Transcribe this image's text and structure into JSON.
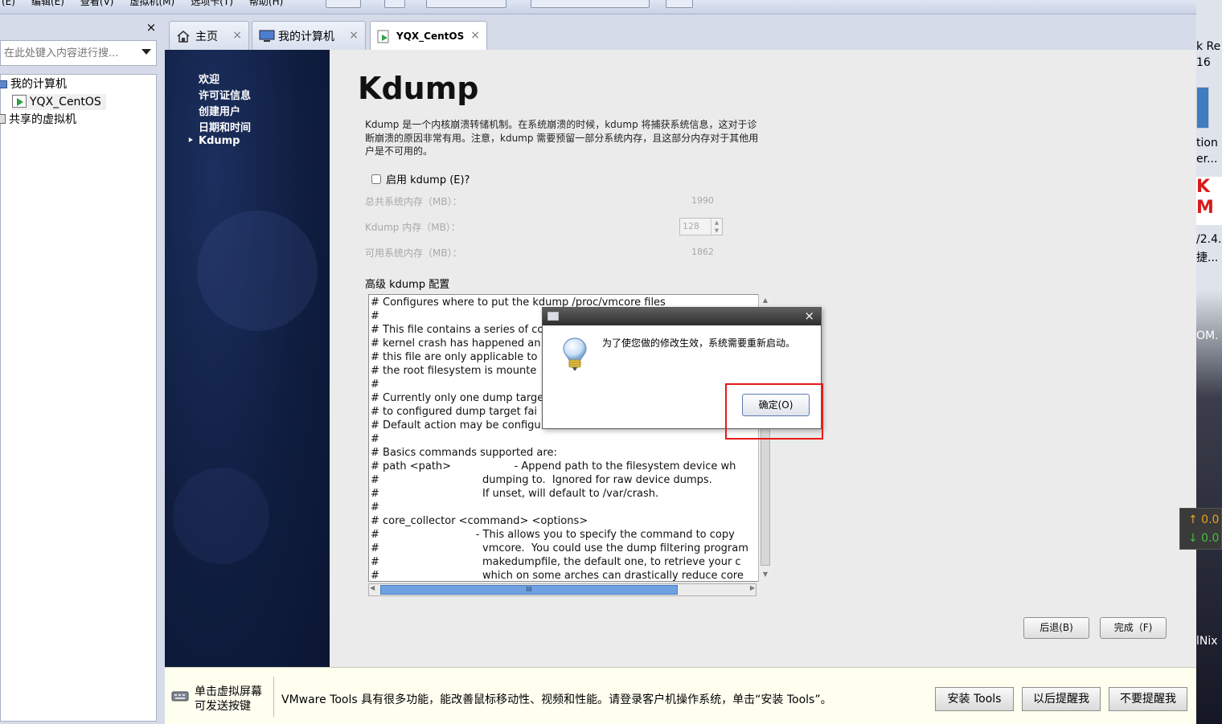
{
  "menubar": {
    "items": [
      "(E)",
      "编辑(E)",
      "查看(V)",
      "虚拟机(M)",
      "选项卡(T)",
      "帮助(H)"
    ]
  },
  "sidebar": {
    "close": "×",
    "search_placeholder": "在此处键入内容进行搜...",
    "tree": [
      {
        "label": "我的计算机"
      },
      {
        "label": "YQX_CentOS"
      },
      {
        "label": "共享的虚拟机"
      }
    ]
  },
  "tabs": [
    {
      "label": "主页",
      "icon": "home-icon",
      "close": "×"
    },
    {
      "label": "我的计算机",
      "icon": "computer-icon",
      "close": "×"
    },
    {
      "label": "YQX_CentOS",
      "icon": "vm-icon",
      "close": "×"
    }
  ],
  "installer": {
    "nav": [
      "欢迎",
      "许可证信息",
      "创建用户",
      "日期和时间",
      "Kdump"
    ],
    "nav_active_marker": "‣",
    "title": "Kdump",
    "description": "Kdump 是一个内核崩溃转储机制。在系统崩溃的时候，kdump 将捕获系统信息，这对于诊断崩溃的原因非常有用。注意，kdump 需要预留一部分系统内存，且这部分内存对于其他用户是不可用的。",
    "enable_label": "启用 kdump (E)?",
    "total_mem_label": "总共系统内存（MB）：",
    "total_mem_value": "1990",
    "kdump_mem_label": "Kdump 内存（MB）：",
    "kdump_mem_value": "128",
    "avail_mem_label": "可用系统内存（MB）：",
    "avail_mem_value": "1862",
    "advanced_label": "高级 kdump 配置",
    "config_text": "# Configures where to put the kdump /proc/vmcore files\n#\n# This file contains a series of co\n# kernel crash has happened an\n# this file are only applicable to\n# the root filesystem is mounte\n#\n# Currently only one dump targe\n# to configured dump target fai\n# Default action may be configu\n#\n# Basics commands supported are:\n# path <path>                   - Append path to the filesystem device wh\n#                               dumping to.  Ignored for raw device dumps.\n#                               If unset, will default to /var/crash.\n#\n# core_collector <command> <options>\n#                             - This allows you to specify the command to copy\n#                               vmcore.  You could use the dump filtering program\n#                               makedumpfile, the default one, to retrieve your c\n#                               which on some arches can drastically reduce core\n#                               size. See /usr/sbin/makedumpfile --help for a list o",
    "hscroll_grip": "III",
    "back_button": "后退(B)",
    "finish_button": "完成（F)"
  },
  "dialog": {
    "message": "为了使您做的修改生效，系统需要重新启动。",
    "ok_button": "确定(O)",
    "close": "×",
    "highlight_color": "#e81a1a"
  },
  "tools_bar": {
    "hint": "单击虚拟屏幕\n可发送按键",
    "message": "VMware Tools 具有很多功能，能改善鼠标移动性、视频和性能。请登录客户机操作系统，单击“安装 Tools”。",
    "install_button": "安装 Tools",
    "later_button": "以后提醒我",
    "never_button": "不要提醒我"
  },
  "right_strip": {
    "texts": [
      "k Re",
      "16",
      "tion",
      "er...",
      "K",
      "M",
      "/2.4.",
      "捷...",
      "OM.",
      "lNix"
    ],
    "net_up": "↑ 0.0",
    "net_down": "↓ 0.0"
  }
}
